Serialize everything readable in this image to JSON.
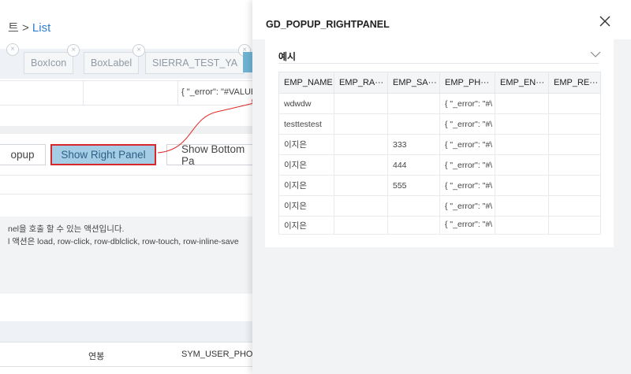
{
  "breadcrumb": {
    "prev": "트",
    "sep": ">",
    "current": "List"
  },
  "tabs": [
    "BoxIcon",
    "BoxLabel",
    "SIERRA_TEST_YA"
  ],
  "bg_table": {
    "error_value": "{ \"_error\": \"#VALUE"
  },
  "buttons": {
    "popup": "opup",
    "right_panel": "Show Right Panel",
    "bottom_panel": "Show Bottom Pa"
  },
  "description": {
    "line1": "nel을 호출 할 수 있는 액션입니다.",
    "line2": "l 액션은 load, row-click, row-dblclick, row-touch, row-inline-save"
  },
  "bottom_grid": {
    "col1": "연봉",
    "col2": "SYM_USER_PHON"
  },
  "panel": {
    "title": "GD_POPUP_RIGHTPANEL",
    "section": "예시",
    "columns": [
      "EMP_NAME",
      "EMP_RA···",
      "EMP_SA···",
      "EMP_PH···",
      "EMP_EN···",
      "EMP_RE···"
    ],
    "rows": [
      {
        "name": "wdwdw",
        "sal": "",
        "ph": "{ \"_error\": \"#\\"
      },
      {
        "name": "testtestest",
        "sal": "",
        "ph": "{ \"_error\": \"#\\"
      },
      {
        "name": "이지은",
        "sal": "333",
        "ph": "{ \"_error\": \"#\\"
      },
      {
        "name": "이지은",
        "sal": "444",
        "ph": "{ \"_error\": \"#\\"
      },
      {
        "name": "이지은",
        "sal": "555",
        "ph": "{ \"_error\": \"#\\"
      },
      {
        "name": "이지은",
        "sal": "",
        "ph": "{ \"_error\": \"#\\"
      },
      {
        "name": "이지은",
        "sal": "",
        "ph": "{ \"_error\": \"#\\"
      }
    ]
  },
  "colors": {
    "accent": "#2f7dd1",
    "highlight_border": "#d9272e",
    "button_fill": "#a6cde6"
  },
  "icons": {
    "close": "close-icon",
    "collapse": "chevron-down-icon",
    "tab_close": "tab-close-icon"
  }
}
